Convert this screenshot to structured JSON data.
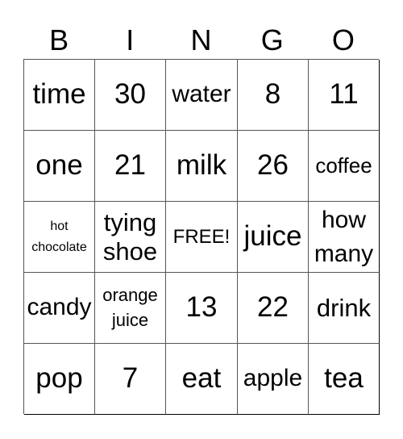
{
  "card": {
    "header": [
      "B",
      "I",
      "N",
      "G",
      "O"
    ],
    "rows": [
      [
        "time",
        "30",
        "water",
        "8",
        "11"
      ],
      [
        "one",
        "21",
        "milk",
        "26",
        "coffee"
      ],
      [
        "hot\nchocolate",
        "tying\nshoe",
        "FREE!",
        "juice",
        "how\nmany"
      ],
      [
        "candy",
        "orange\njuice",
        "13",
        "22",
        "drink"
      ],
      [
        "pop",
        "7",
        "eat",
        "apple",
        "tea"
      ]
    ],
    "free_space": "FREE!"
  },
  "colors": {
    "grid_line": "#555555",
    "text": "#000000",
    "background": "#ffffff"
  }
}
